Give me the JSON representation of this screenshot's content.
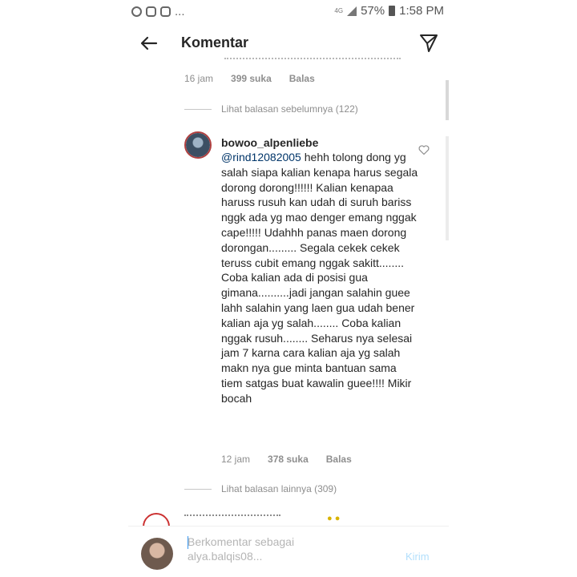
{
  "status_bar": {
    "icons": [
      "messenger-icon",
      "instagram-icon",
      "instagram-icon"
    ],
    "more": "...",
    "network": "4G",
    "battery_percent": "57%",
    "time": "1:58 PM"
  },
  "header": {
    "title": "Komentar",
    "back_icon": "arrow-left-icon",
    "send_icon": "paper-plane-icon"
  },
  "prev_comment": {
    "time": "16 jam",
    "likes": "399 suka",
    "reply": "Balas"
  },
  "view_previous": "Lihat balasan sebelumnya (122)",
  "comment": {
    "username": "bowoo_alpenliebe",
    "mention": "@rind12082005",
    "text": " hehh tolong dong yg salah siapa kalian kenapa harus segala dorong dorong!!!!!! Kalian kenapaa haruss rusuh kan udah di suruh bariss nggk ada yg mao denger emang nggak cape!!!!! Udahhh panas maen dorong dorongan......... Segala cekek cekek teruss cubit emang nggak sakitt........ Coba kalian ada di posisi gua gimana..........jadi jangan salahin guee lahh salahin yang laen gua udah bener kalian aja yg salah........ Coba kalian nggak rusuh........ Seharus nya selesai jam 7 karna cara kalian aja yg salah makn nya gue minta bantuan sama tiem satgas buat kawalin guee!!!! Mikir bocah",
    "time": "12 jam",
    "likes": "378 suka",
    "reply": "Balas"
  },
  "view_more": "Lihat balasan lainnya (309)",
  "composer": {
    "placeholder": "Berkomentar sebagai alya.balqis08...",
    "post": "Kirim"
  }
}
